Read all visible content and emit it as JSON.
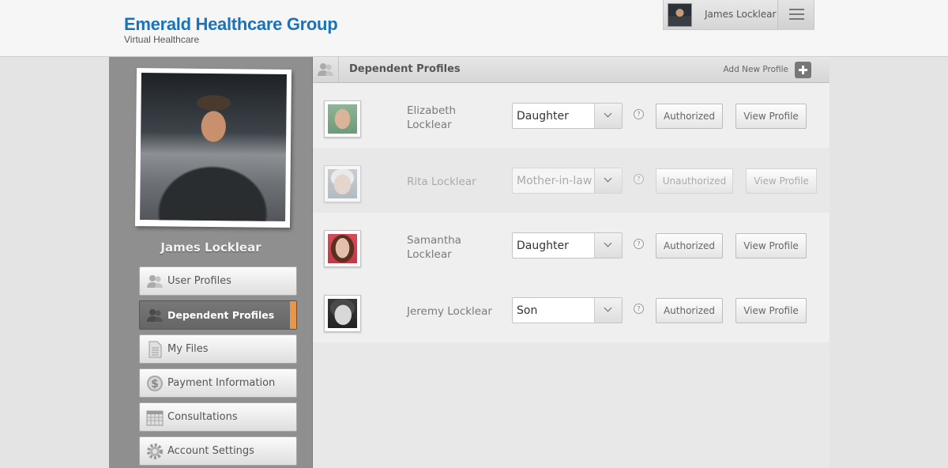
{
  "header": {
    "brand_title": "Emerald Healthcare Group",
    "brand_subtitle": "Virtual Healthcare",
    "user_name": "James Locklear"
  },
  "sidebar": {
    "profile_name": "James Locklear",
    "items": [
      {
        "label": "User Profiles",
        "icon": "users-icon",
        "active": false
      },
      {
        "label": "Dependent Profiles",
        "icon": "users-icon",
        "active": true
      },
      {
        "label": "My Files",
        "icon": "file-icon",
        "active": false
      },
      {
        "label": "Payment Information",
        "icon": "dollar-icon",
        "active": false
      },
      {
        "label": "Consultations",
        "icon": "calendar-icon",
        "active": false
      },
      {
        "label": "Account Settings",
        "icon": "gear-icon",
        "active": false
      }
    ],
    "active_accent": "#e8964a"
  },
  "main": {
    "title": "Dependent Profiles",
    "add_label": "Add New Profile",
    "dependents": [
      {
        "name": "Elizabeth Locklear",
        "relationship": "Daughter",
        "status": "Authorized",
        "view_label": "View Profile",
        "help": "?"
      },
      {
        "name": "Rita Locklear",
        "relationship": "Mother-in-law",
        "status": "Unauthorized",
        "view_label": "View Profile",
        "help": "?"
      },
      {
        "name": "Samantha Locklear",
        "relationship": "Daughter",
        "status": "Authorized",
        "view_label": "View Profile",
        "help": "?"
      },
      {
        "name": "Jeremy Locklear",
        "relationship": "Son",
        "status": "Authorized",
        "view_label": "View Profile",
        "help": "?"
      }
    ]
  },
  "colors": {
    "brand": "#1a73b8"
  }
}
